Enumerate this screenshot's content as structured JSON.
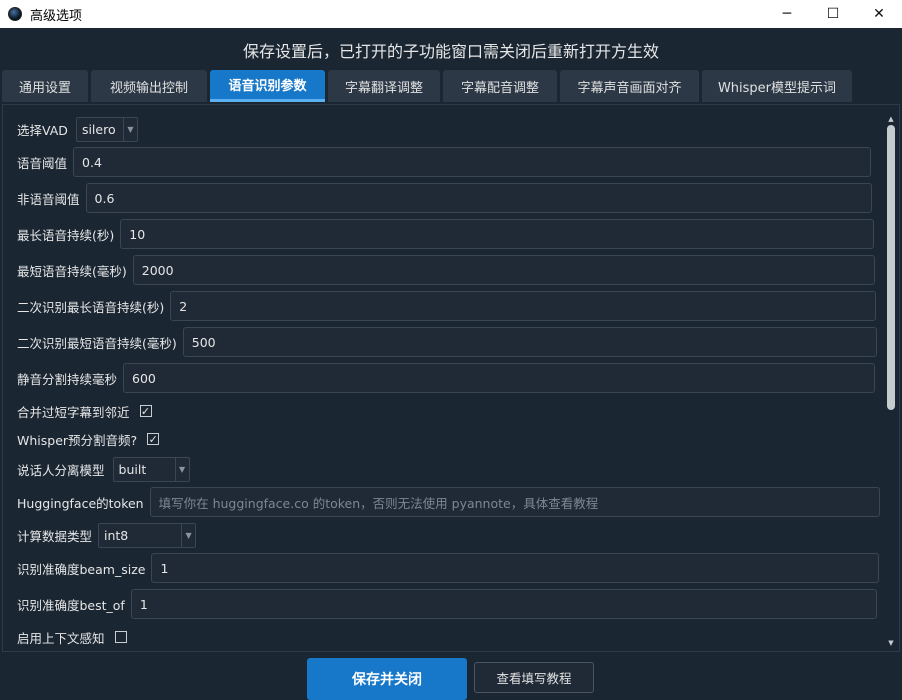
{
  "window": {
    "title": "高级选项",
    "minimize_icon": "─",
    "maximize_icon": "☐",
    "close_icon": "✕"
  },
  "banner": "保存设置后，已打开的子功能窗口需关闭后重新打开方生效",
  "tabs": [
    {
      "label": "通用设置",
      "active": false
    },
    {
      "label": "视频输出控制",
      "active": false
    },
    {
      "label": "语音识别参数",
      "active": true
    },
    {
      "label": "字幕翻译调整",
      "active": false
    },
    {
      "label": "字幕配音调整",
      "active": false
    },
    {
      "label": "字幕声音画面对齐",
      "active": false
    },
    {
      "label": "Whisper模型提示词",
      "active": false
    }
  ],
  "form": {
    "vad": {
      "label": "选择VAD",
      "value": "silero"
    },
    "speech_threshold": {
      "label": "语音阈值",
      "value": "0.4"
    },
    "nonspeech_threshold": {
      "label": "非语音阈值",
      "value": "0.6"
    },
    "max_speech_duration": {
      "label": "最长语音持续(秒)",
      "value": "10"
    },
    "min_speech_duration": {
      "label": "最短语音持续(毫秒)",
      "value": "2000"
    },
    "second_max_speech": {
      "label": "二次识别最长语音持续(秒)",
      "value": "2"
    },
    "second_min_speech": {
      "label": "二次识别最短语音持续(毫秒)",
      "value": "500"
    },
    "silence_split": {
      "label": "静音分割持续毫秒",
      "value": "600"
    },
    "merge_short": {
      "label": "合并过短字幕到邻近",
      "checked": true,
      "mark": "✓"
    },
    "whisper_presplit": {
      "label": "Whisper预分割音频?",
      "checked": true,
      "mark": "✓"
    },
    "speaker_model": {
      "label": "说话人分离模型",
      "value": "built"
    },
    "hf_token": {
      "label": "Huggingface的token",
      "placeholder": "填写你在 huggingface.co 的token，否则无法使用 pyannote，具体查看教程"
    },
    "compute_type": {
      "label": "计算数据类型",
      "value": "int8"
    },
    "beam_size": {
      "label": "识别准确度beam_size",
      "value": "1"
    },
    "best_of": {
      "label": "识别准确度best_of",
      "value": "1"
    },
    "context_aware": {
      "label": "启用上下文感知",
      "checked": false,
      "mark": ""
    }
  },
  "buttons": {
    "save_close": "保存并关闭",
    "view_tutorial": "查看填写教程"
  },
  "colors": {
    "background": "#1b2633",
    "accent": "#1778c9",
    "input_bg": "#1f2a36"
  }
}
